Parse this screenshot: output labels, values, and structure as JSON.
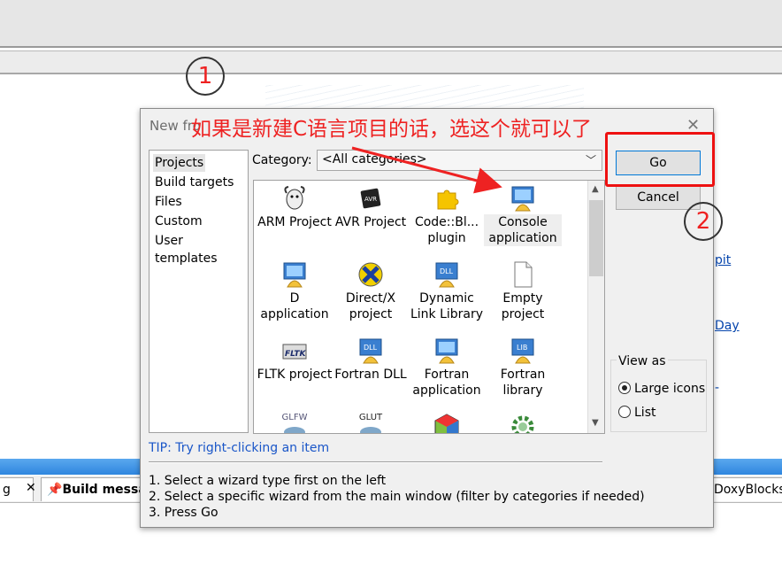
{
  "background": {
    "links": [
      "pit",
      "Day",
      "-"
    ],
    "tabs": [
      {
        "label": "g",
        "selected": false
      },
      {
        "label": "Build messa",
        "selected": true
      },
      {
        "label": "DoxyBlocks",
        "selected": false
      }
    ]
  },
  "dialog": {
    "title": "New fro",
    "left_list": [
      "Projects",
      "Build targets",
      "Files",
      "Custom",
      "User templates"
    ],
    "selected_left": "Projects",
    "category_label": "Category:",
    "category_value": "<All categories>",
    "items": [
      {
        "label": "ARM Project",
        "icon": "gnu-icon"
      },
      {
        "label": "AVR Project",
        "icon": "avr-chip-icon"
      },
      {
        "label": "Code::Bl... plugin",
        "icon": "puzzle-icon"
      },
      {
        "label": "Console application",
        "icon": "console-app-icon",
        "selected": true
      },
      {
        "label": "D application",
        "icon": "d-app-icon"
      },
      {
        "label": "Direct/X project",
        "icon": "directx-icon"
      },
      {
        "label": "Dynamic Link Library",
        "icon": "dll-icon"
      },
      {
        "label": "Empty project",
        "icon": "blank-page-icon"
      },
      {
        "label": "FLTK project",
        "icon": "fltk-icon"
      },
      {
        "label": "Fortran DLL",
        "icon": "fortran-dll-icon"
      },
      {
        "label": "Fortran application",
        "icon": "fortran-app-icon"
      },
      {
        "label": "Fortran library",
        "icon": "fortran-lib-icon"
      },
      {
        "label": "GLFW",
        "icon": "glfw-icon"
      },
      {
        "label": "GLUT",
        "icon": "glut-icon"
      },
      {
        "label": "",
        "icon": "gtk-icon"
      },
      {
        "label": "",
        "icon": "gear-icon"
      }
    ],
    "go_label": "Go",
    "cancel_label": "Cancel",
    "view_as_label": "View as",
    "view_options": [
      "Large icons",
      "List"
    ],
    "view_selected": "Large icons",
    "tip": "TIP: Try right-clicking an item",
    "instructions": [
      "1. Select a wizard type first on the left",
      "2. Select a specific wizard from the main window (filter by categories if needed)",
      "3. Press Go"
    ]
  },
  "annotations": {
    "text": "如果是新建C语言项目的话，选这个就可以了",
    "marker1": "1",
    "marker2": "2",
    "color": "#ee2222"
  }
}
